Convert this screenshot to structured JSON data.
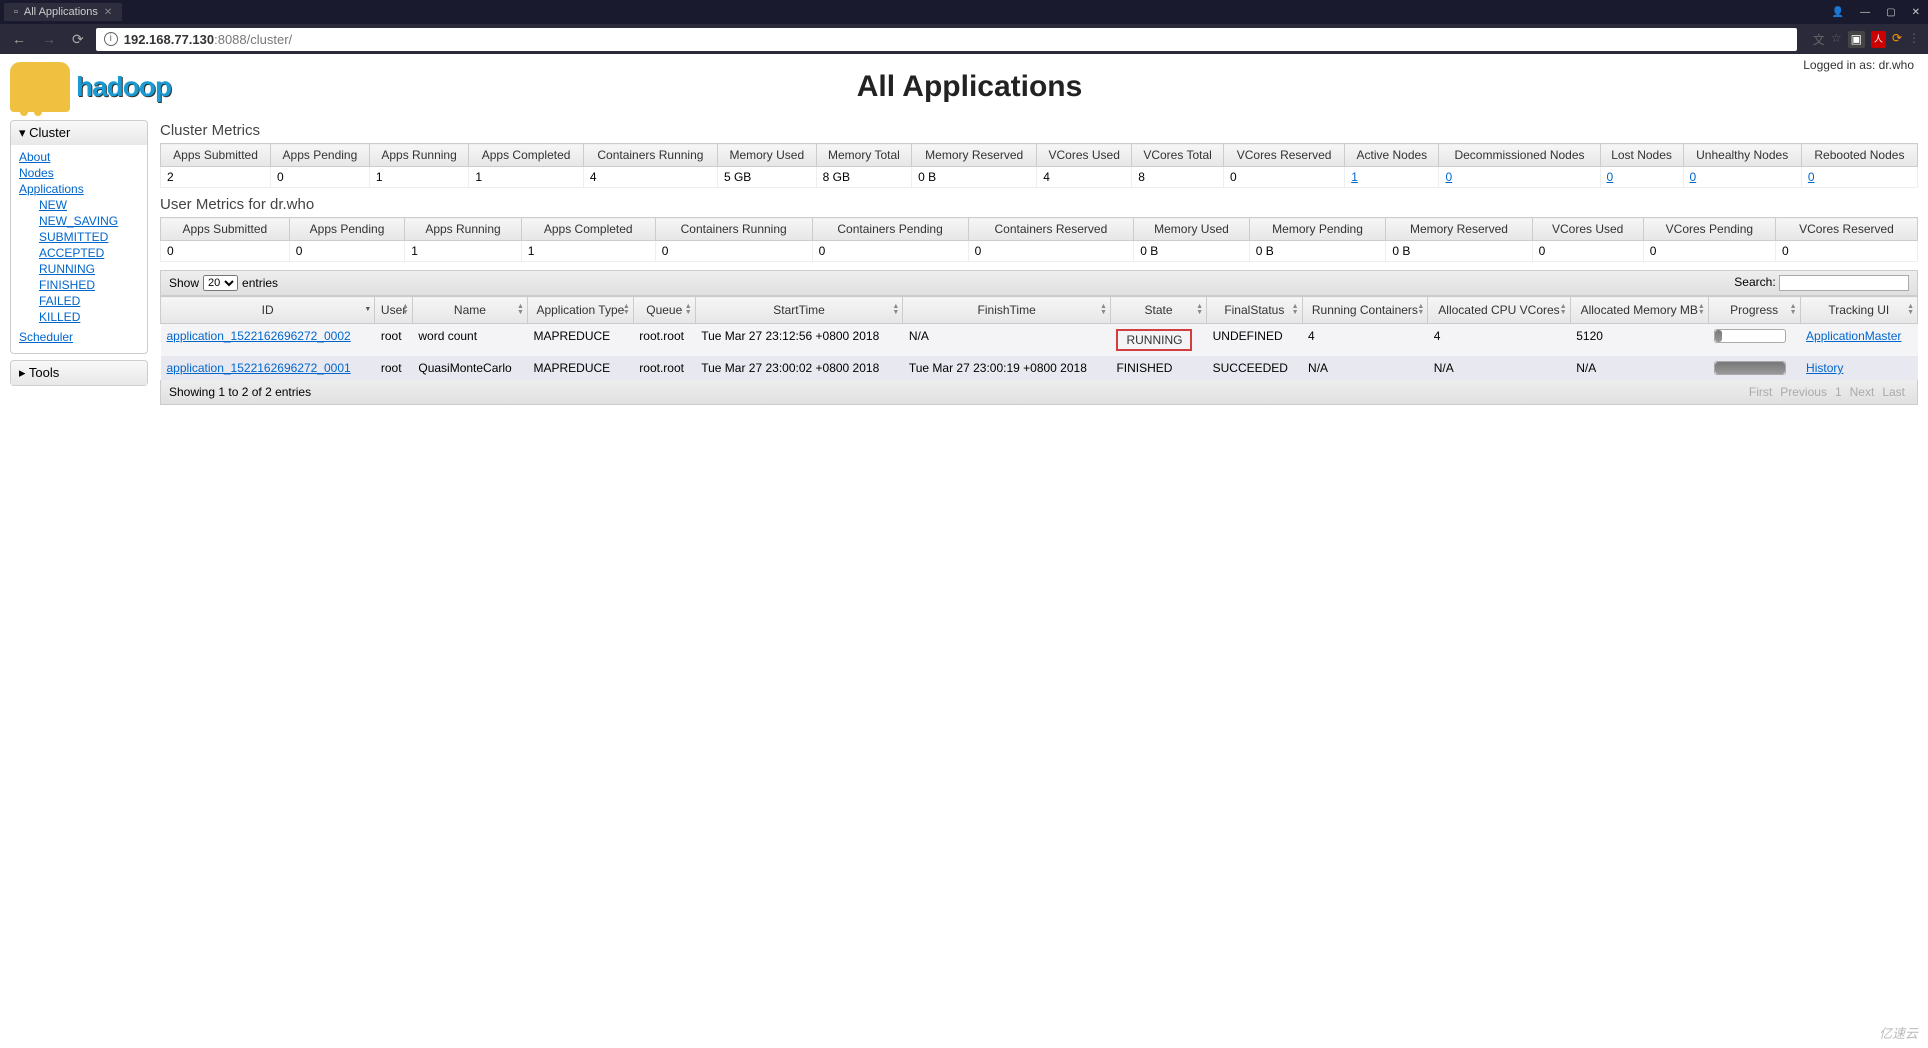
{
  "browser": {
    "tab_title": "All Applications",
    "url_prefix": "192.168.77.130",
    "url_suffix": ":8088/cluster/"
  },
  "header": {
    "logo_text": "hadoop",
    "page_title": "All Applications",
    "login_info": "Logged in as: dr.who"
  },
  "sidebar": {
    "cluster_label": "Cluster",
    "tools_label": "Tools",
    "links": {
      "about": "About",
      "nodes": "Nodes",
      "applications": "Applications",
      "scheduler": "Scheduler"
    },
    "app_states": [
      "NEW",
      "NEW_SAVING",
      "SUBMITTED",
      "ACCEPTED",
      "RUNNING",
      "FINISHED",
      "FAILED",
      "KILLED"
    ]
  },
  "cluster_metrics": {
    "title": "Cluster Metrics",
    "headers": [
      "Apps Submitted",
      "Apps Pending",
      "Apps Running",
      "Apps Completed",
      "Containers Running",
      "Memory Used",
      "Memory Total",
      "Memory Reserved",
      "VCores Used",
      "VCores Total",
      "VCores Reserved",
      "Active Nodes",
      "Decommissioned Nodes",
      "Lost Nodes",
      "Unhealthy Nodes",
      "Rebooted Nodes"
    ],
    "values": [
      "2",
      "0",
      "1",
      "1",
      "4",
      "5 GB",
      "8 GB",
      "0 B",
      "4",
      "8",
      "0",
      "1",
      "0",
      "0",
      "0",
      "0"
    ],
    "link_cols": [
      11,
      12,
      13,
      14,
      15
    ]
  },
  "user_metrics": {
    "title": "User Metrics for dr.who",
    "headers": [
      "Apps Submitted",
      "Apps Pending",
      "Apps Running",
      "Apps Completed",
      "Containers Running",
      "Containers Pending",
      "Containers Reserved",
      "Memory Used",
      "Memory Pending",
      "Memory Reserved",
      "VCores Used",
      "VCores Pending",
      "VCores Reserved"
    ],
    "values": [
      "0",
      "0",
      "1",
      "1",
      "0",
      "0",
      "0",
      "0 B",
      "0 B",
      "0 B",
      "0",
      "0",
      "0"
    ]
  },
  "datatable": {
    "show_label": "Show",
    "show_value": "20",
    "entries_label": "entries",
    "search_label": "Search:",
    "columns": [
      "ID",
      "User",
      "Name",
      "Application Type",
      "Queue",
      "StartTime",
      "FinishTime",
      "State",
      "FinalStatus",
      "Running Containers",
      "Allocated CPU VCores",
      "Allocated Memory MB",
      "Progress",
      "Tracking UI"
    ],
    "rows": [
      {
        "id": "application_1522162696272_0002",
        "user": "root",
        "name": "word count",
        "type": "MAPREDUCE",
        "queue": "root.root",
        "start": "Tue Mar 27 23:12:56 +0800 2018",
        "finish": "N/A",
        "state": "RUNNING",
        "state_highlight": true,
        "final": "UNDEFINED",
        "containers": "4",
        "vcores": "4",
        "memory": "5120",
        "progress": 10,
        "tracking": "ApplicationMaster"
      },
      {
        "id": "application_1522162696272_0001",
        "user": "root",
        "name": "QuasiMonteCarlo",
        "type": "MAPREDUCE",
        "queue": "root.root",
        "start": "Tue Mar 27 23:00:02 +0800 2018",
        "finish": "Tue Mar 27 23:00:19 +0800 2018",
        "state": "FINISHED",
        "state_highlight": false,
        "final": "SUCCEEDED",
        "containers": "N/A",
        "vcores": "N/A",
        "memory": "N/A",
        "progress": 100,
        "tracking": "History"
      }
    ],
    "info_text": "Showing 1 to 2 of 2 entries",
    "pager": [
      "First",
      "Previous",
      "1",
      "Next",
      "Last"
    ]
  },
  "watermark": "亿速云"
}
